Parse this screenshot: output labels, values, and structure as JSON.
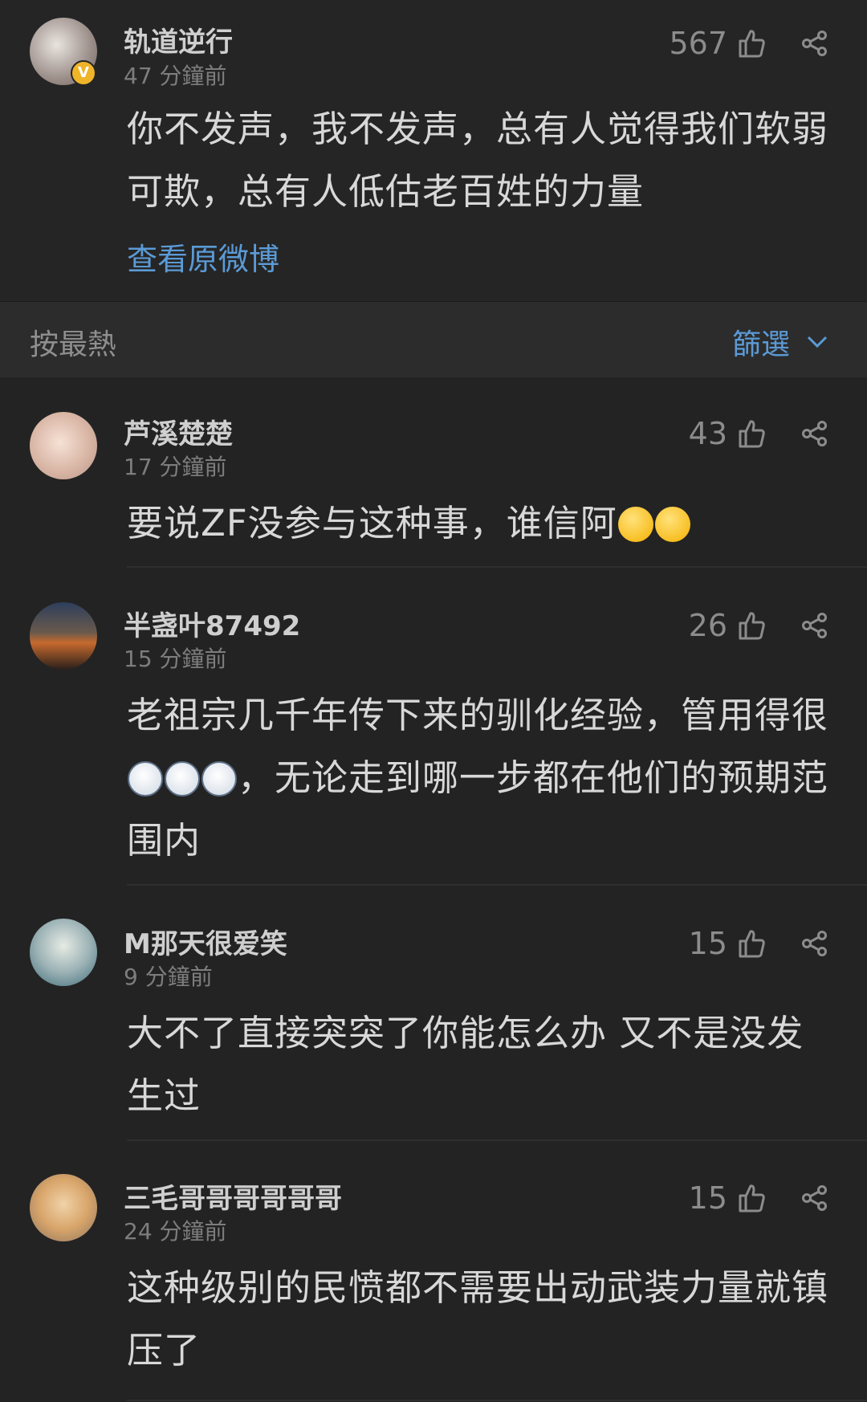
{
  "post": {
    "username": "轨道逆行",
    "time": "47 分鐘前",
    "likes": "567",
    "text": "你不发声，我不发声，总有人觉得我们软弱可欺，总有人低估老百姓的力量",
    "view_original": "查看原微博",
    "verified_badge": "V"
  },
  "sort_bar": {
    "sort_label": "按最熱",
    "filter_label": "篩選"
  },
  "comments": [
    {
      "username": "芦溪楚楚",
      "time": "17 分鐘前",
      "likes": "43",
      "text": "要说ZF没参与这种事，谁信阿",
      "emojis": [
        "hug",
        "hug"
      ]
    },
    {
      "username": "半盏叶87492",
      "time": "15 分鐘前",
      "likes": "26",
      "text_before": "老祖宗几千年传下来的驯化经验，管用得很",
      "text_after": "，无论走到哪一步都在他们的预期范围内",
      "emojis": [
        "doge",
        "doge",
        "doge"
      ]
    },
    {
      "username": "M那天很爱笑",
      "time": "9 分鐘前",
      "likes": "15",
      "text": "大不了直接突突了你能怎么办 又不是没发生过"
    },
    {
      "username": "三毛哥哥哥哥哥哥",
      "time": "24 分鐘前",
      "likes": "15",
      "text": "这种级别的民愤都不需要出动武装力量就镇压了"
    }
  ],
  "colors": {
    "background": "#232323",
    "link": "#5b9ad6",
    "muted": "#7d7d7d"
  }
}
